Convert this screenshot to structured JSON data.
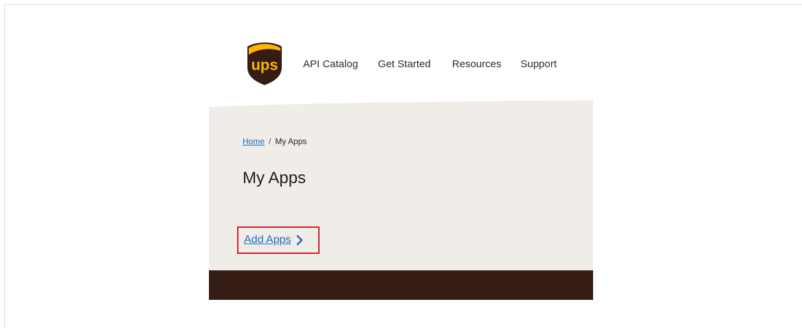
{
  "brand": {
    "logo_text": "ups",
    "colors": {
      "shield_brown": "#351c15",
      "shield_gold": "#ffb500",
      "link_blue": "#1a6dbf",
      "highlight_red": "#d0202f",
      "hero_bg": "#f0ece8",
      "footer_brown": "#351c15"
    }
  },
  "nav": {
    "items": [
      {
        "label": "API Catalog"
      },
      {
        "label": "Get Started"
      },
      {
        "label": "Resources"
      },
      {
        "label": "Support"
      }
    ]
  },
  "breadcrumb": {
    "home": "Home",
    "separator": "/",
    "current": "My Apps"
  },
  "page": {
    "title": "My Apps"
  },
  "actions": {
    "add_apps_label": "Add Apps",
    "add_apps_icon": "chevron-right-icon"
  }
}
